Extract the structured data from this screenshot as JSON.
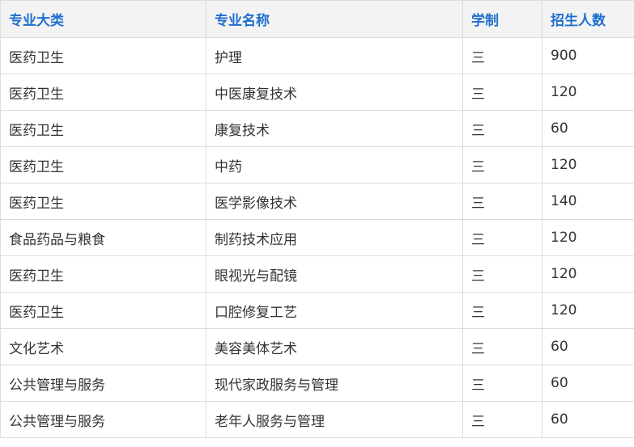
{
  "table": {
    "headers": [
      "专业大类",
      "专业名称",
      "学制",
      "招生人数"
    ],
    "rows": [
      [
        "医药卫生",
        "护理",
        "三",
        "900"
      ],
      [
        "医药卫生",
        "中医康复技术",
        "三",
        "120"
      ],
      [
        "医药卫生",
        "康复技术",
        "三",
        "60"
      ],
      [
        "医药卫生",
        "中药",
        "三",
        "120"
      ],
      [
        "医药卫生",
        "医学影像技术",
        "三",
        "140"
      ],
      [
        "食品药品与粮食",
        "制药技术应用",
        "三",
        "120"
      ],
      [
        "医药卫生",
        "眼视光与配镜",
        "三",
        "120"
      ],
      [
        "医药卫生",
        "口腔修复工艺",
        "三",
        "120"
      ],
      [
        "文化艺术",
        "美容美体艺术",
        "三",
        "60"
      ],
      [
        "公共管理与服务",
        "现代家政服务与管理",
        "三",
        "60"
      ],
      [
        "公共管理与服务",
        "老年人服务与管理",
        "三",
        "60"
      ]
    ]
  },
  "colors": {
    "header_text": "#1f6fd0",
    "header_bg": "#f3f3f3",
    "border": "#dcdcdc",
    "body_text": "#333333"
  }
}
